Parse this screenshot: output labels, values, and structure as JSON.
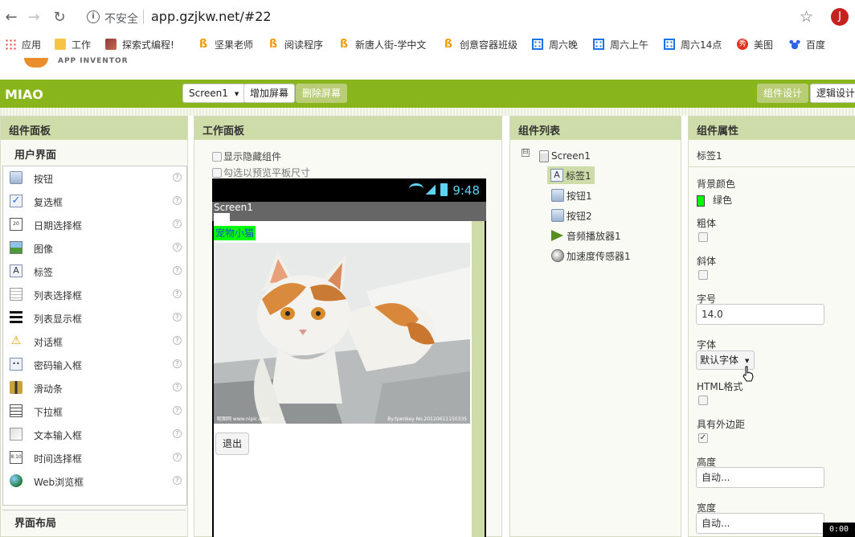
{
  "browser": {
    "security_label": "不安全",
    "url": "app.gzjkw.net/#22",
    "avatar_letter": "J",
    "bookmarks": [
      "应用",
      "工作",
      "探索式编程!",
      "坚果老师",
      "阅读程序",
      "新唐人街-学中文",
      "创意容器班级",
      "周六晚",
      "周六上午",
      "周六14点",
      "美图",
      "百度"
    ]
  },
  "logo": {
    "text": "APP INVENTOR"
  },
  "toolbar": {
    "project_name": "MIAO",
    "screen_select": "Screen1",
    "add_screen": "增加屏幕",
    "remove_screen": "删除屏幕",
    "designer": "组件设计",
    "blocks": "逻辑设计"
  },
  "palette": {
    "title": "组件面板",
    "section": "用户界面",
    "items": [
      "按钮",
      "复选框",
      "日期选择框",
      "图像",
      "标签",
      "列表选择框",
      "列表显示框",
      "对话框",
      "密码输入框",
      "滑动条",
      "下拉框",
      "文本输入框",
      "时间选择框",
      "Web浏览框"
    ],
    "help_mark": "?",
    "next_section": "界面布局"
  },
  "viewer": {
    "title": "工作面板",
    "show_hidden": "显示隐藏组件",
    "tablet_preview": "勾选以预览平板尺寸",
    "status_time": "9:48",
    "screen_title": "Screen1",
    "label_text": "宠物小猫",
    "img_caption_left": "昵图网 www.nipic.com",
    "img_caption_right": "By:tpenkey No.20120611150335",
    "button_text": "退出"
  },
  "components": {
    "title": "组件列表",
    "toggle": "⊟",
    "tree": [
      "Screen1",
      "标签1",
      "按钮1",
      "按钮2",
      "音频播放器1",
      "加速度传感器1"
    ]
  },
  "properties": {
    "title": "组件属性",
    "component_name": "标签1",
    "bg_color_label": "背景颜色",
    "bg_color_value": "绿色",
    "bold_label": "粗体",
    "italic_label": "斜体",
    "fontsize_label": "字号",
    "fontsize_value": "14.0",
    "font_label": "字体",
    "font_value": "默认字体",
    "html_label": "HTML格式",
    "margin_label": "具有外边距",
    "check_mark": "✓",
    "height_label": "高度",
    "height_value": "自动...",
    "width_label": "宽度",
    "width_value": "自动..."
  },
  "overlay": {
    "timer": "0:00"
  },
  "colors": {
    "toolbar_green": "#88b41c",
    "panel_header": "#cddca8",
    "label_bg": "#00ff00"
  }
}
